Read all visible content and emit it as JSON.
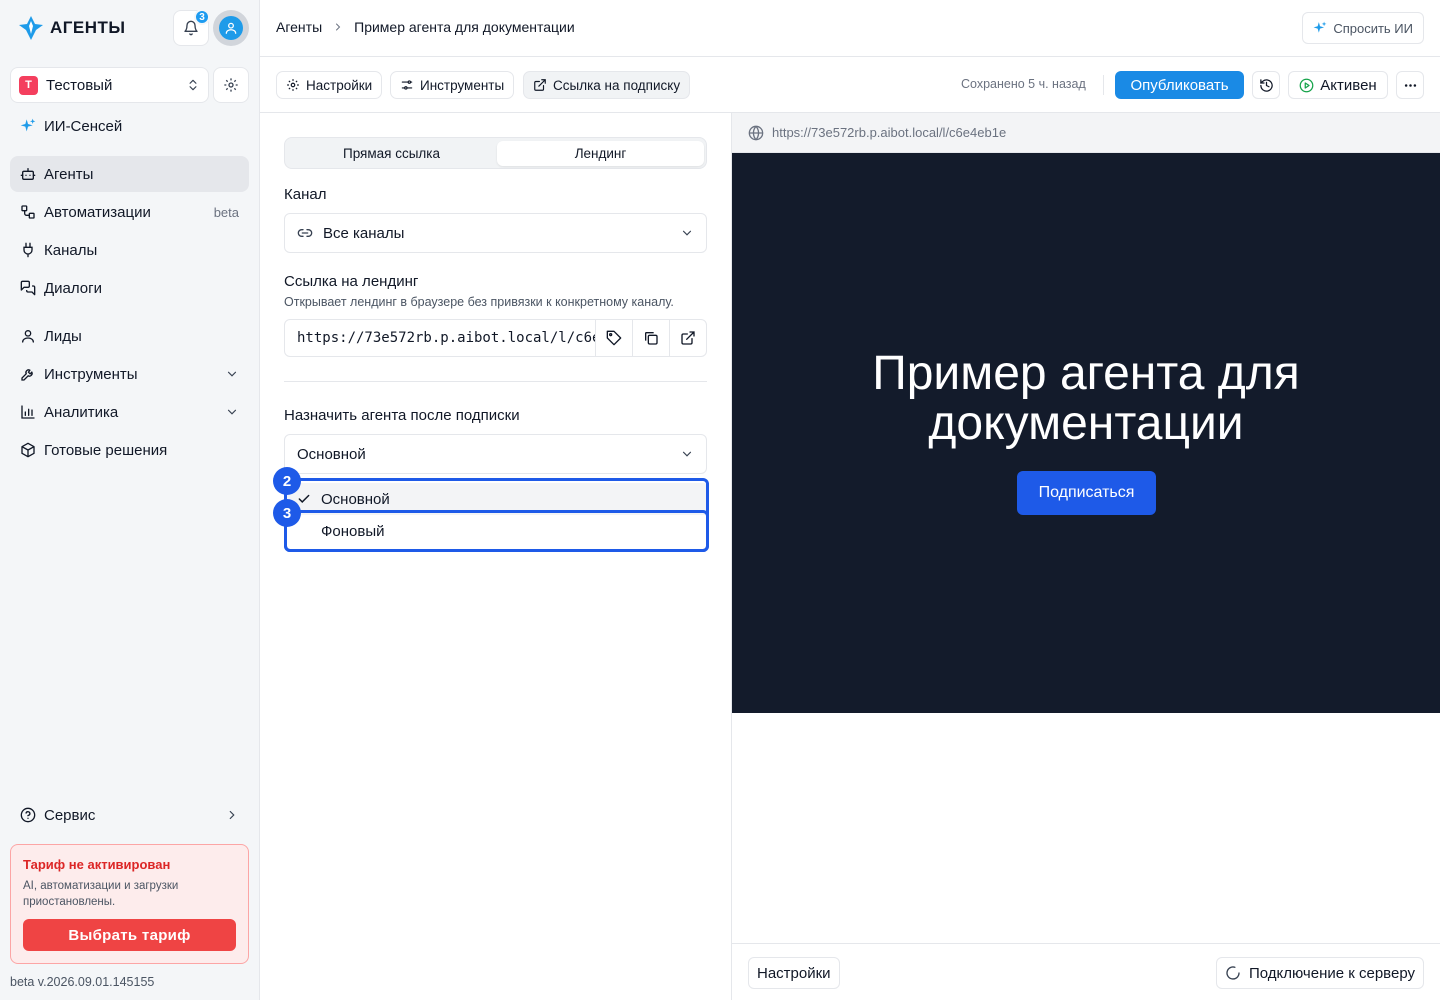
{
  "app": {
    "logo_text": "АГЕНТЫ",
    "notif_count": "3"
  },
  "workspace": {
    "badge": "Т",
    "name": "Тестовый"
  },
  "sidebar": {
    "items": [
      {
        "label": "ИИ-Сенсей",
        "icon": "sparkle-icon"
      },
      {
        "label": "Агенты",
        "icon": "bot-icon",
        "active": true
      },
      {
        "label": "Автоматизации",
        "badge": "beta",
        "icon": "workflow-icon"
      },
      {
        "label": "Каналы",
        "icon": "plug-icon"
      },
      {
        "label": "Диалоги",
        "icon": "chat-icon"
      },
      {
        "label": "Лиды",
        "icon": "user-icon"
      },
      {
        "label": "Инструменты",
        "icon": "tools-icon"
      },
      {
        "label": "Аналитика",
        "icon": "chart-icon"
      },
      {
        "label": "Готовые решения",
        "icon": "package-icon"
      }
    ],
    "service_label": "Сервис"
  },
  "tariff": {
    "title": "Тариф не активирован",
    "desc": "AI, автоматизации и загрузки приостановлены.",
    "button": "Выбрать тариф"
  },
  "version": "beta v.2026.09.01.145155",
  "topbar": {
    "crumb1": "Агенты",
    "crumb2": "Пример агента для документации",
    "ask_ai": "Спросить ИИ"
  },
  "toolbar": {
    "settings": "Настройки",
    "tools": "Инструменты",
    "sub_link": "Ссылка на подписку",
    "saved": "Сохранено 5 ч. назад",
    "publish": "Опубликовать",
    "status": "Активен"
  },
  "panel": {
    "seg_direct": "Прямая ссылка",
    "seg_landing": "Лендинг",
    "channel_label": "Канал",
    "channel_value": "Все каналы",
    "landing_label": "Ссылка на лендинг",
    "landing_desc": "Открывает лендинг в браузере без привязки к конкретному каналу.",
    "landing_url": "https://73e572rb.p.aibot.local/l/c6e4eb1e",
    "assign_label": "Назначить агента после подписки",
    "assign_value": "Основной",
    "options": [
      "Основной",
      "Фоновый"
    ],
    "markers": [
      "2",
      "3"
    ]
  },
  "preview": {
    "url": "https://73e572rb.p.aibot.local/l/c6e4eb1e",
    "title": "Пример агента для документации",
    "subscribe": "Подписаться",
    "settings": "Настройки",
    "connecting": "Подключение к серверу"
  },
  "colors": {
    "accent": "#1e5ae8",
    "publish": "#1a8ae5",
    "danger": "#ef4444",
    "landing_bg": "#131b2b"
  }
}
